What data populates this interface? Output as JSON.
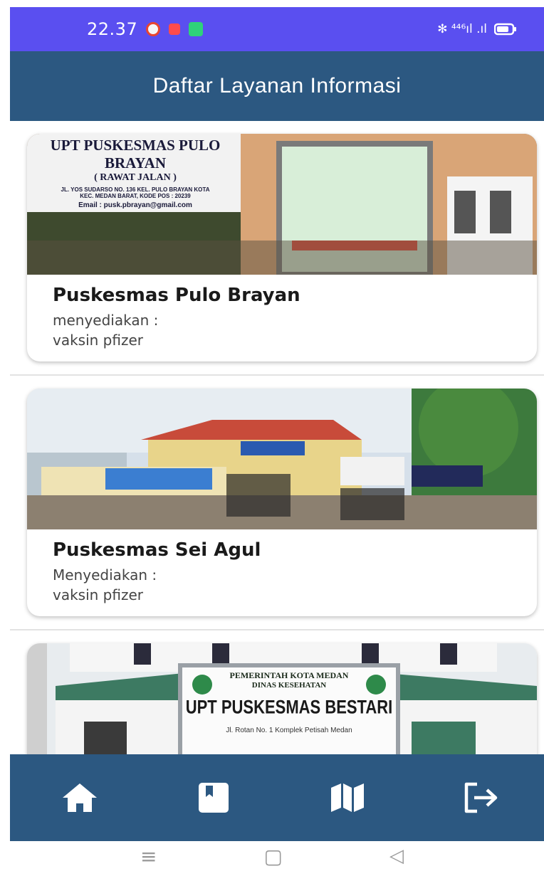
{
  "status_bar": {
    "time": "22.37",
    "right_text": "✻ ⁴⁴⁶ıl .ıl",
    "colors": {
      "background": "#5a4ff0"
    }
  },
  "app_bar": {
    "title": "Daftar Layanan Informasi",
    "colors": {
      "background": "#2c5881"
    }
  },
  "cards": [
    {
      "title": "Puskesmas Pulo Brayan",
      "description": "menyediakan :\nvaksin pfizer",
      "sign_title": "UPT PUSKESMAS PULO BRAYAN",
      "sign_subtitle": "( RAWAT JALAN )",
      "sign_address": "JL. YOS SUDARSO NO. 136  KEL. PULO BRAYAN KOTA",
      "sign_address2": "KEC. MEDAN BARAT, KODE POS : 20239",
      "sign_email": "Email : pusk.pbrayan@gmail.com"
    },
    {
      "title": "Puskesmas Sei Agul",
      "description": "Menyediakan :\nvaksin pfizer"
    },
    {
      "title": "",
      "description": "",
      "sign_header": "PEMERINTAH KOTA MEDAN",
      "sign_header2": "DINAS KESEHATAN",
      "sign_title": "UPT PUSKESMAS BESTARI",
      "sign_address": "Jl. Rotan No. 1 Komplek Petisah Medan"
    }
  ],
  "bottom_nav": {
    "items": [
      {
        "icon": "home-icon"
      },
      {
        "icon": "book-icon"
      },
      {
        "icon": "map-icon"
      },
      {
        "icon": "logout-icon"
      }
    ],
    "colors": {
      "background": "#2c5881",
      "icon": "#ffffff"
    }
  },
  "system_nav": {
    "menu": "≡",
    "home": "▢",
    "back": "◁"
  }
}
